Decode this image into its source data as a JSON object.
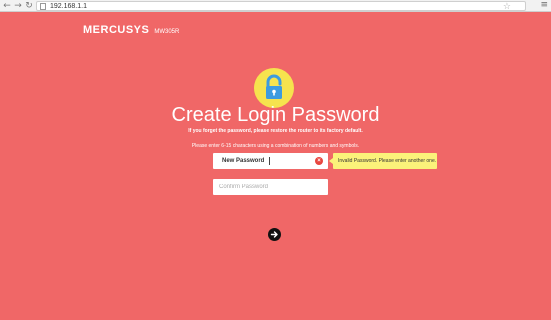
{
  "browser": {
    "url": "192.168.1.1",
    "icons": {
      "back": "back-arrow-icon",
      "forward": "forward-arrow-icon",
      "reload": "reload-icon",
      "bookmark": "star-icon",
      "menu": "hamburger-menu-icon"
    }
  },
  "header": {
    "logo": "MERCUSYS",
    "model": "MW305R"
  },
  "main": {
    "lock_icon": "padlock-icon",
    "title": "Create Login Password",
    "subtitle": "If you forget the password, please restore the router to its factory default.",
    "hint": "Please enter 6-15 characters using a combination of numbers and symbols.",
    "new_password": {
      "label": "New Password",
      "value": ""
    },
    "confirm_password": {
      "placeholder": "Confirm Password",
      "value": ""
    },
    "error_tooltip": "Invalid Password. Please enter another one.",
    "next_icon": "arrow-right-icon"
  },
  "colors": {
    "background": "#f06767",
    "lock_circle": "#f6e34e",
    "tooltip": "#fbf27a",
    "error": "#e8463f"
  }
}
